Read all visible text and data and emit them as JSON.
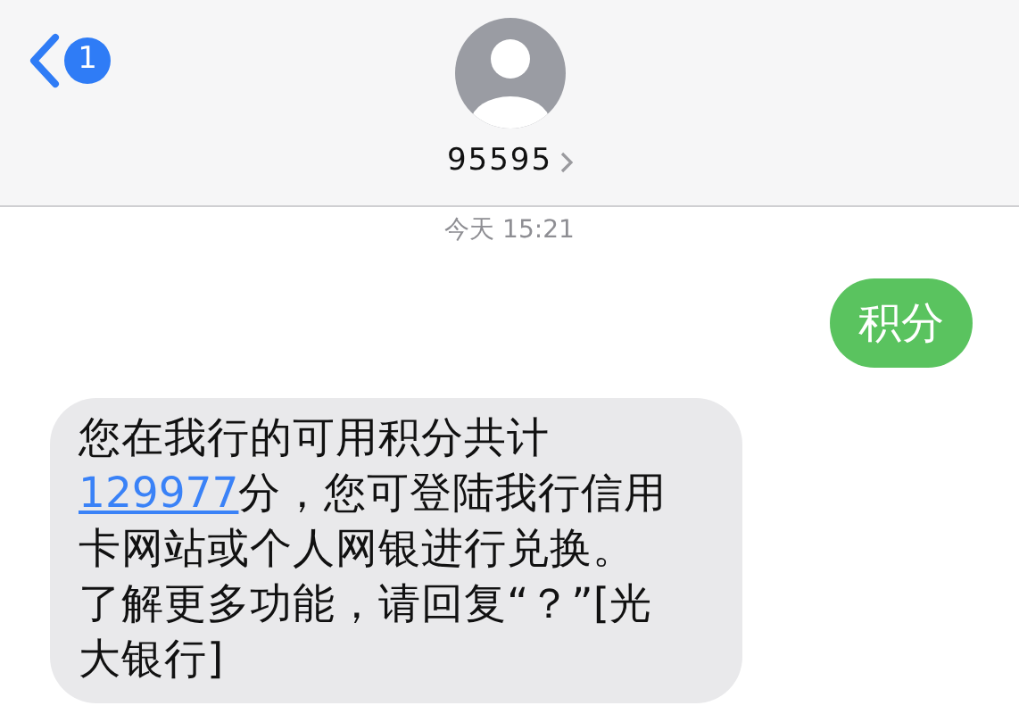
{
  "header": {
    "unread_count": "1",
    "contact_name": "95595"
  },
  "timestamp": "今天 15:21",
  "messages": [
    {
      "kind": "sent",
      "lines": [
        [
          {
            "kind": "text",
            "text": "积分"
          }
        ]
      ]
    },
    {
      "kind": "received",
      "lines": [
        [
          {
            "kind": "text",
            "text": "您在我行的可用积分共计"
          }
        ],
        [
          {
            "kind": "link",
            "text": "129977"
          },
          {
            "kind": "text",
            "text": "分，您可登陆我行信用"
          }
        ],
        [
          {
            "kind": "text",
            "text": "卡网站或个人网银进行兑换。"
          }
        ],
        [
          {
            "kind": "text",
            "text": "了解更多功能，请回复“？”[光"
          }
        ],
        [
          {
            "kind": "text",
            "text": "大银行]"
          }
        ]
      ]
    }
  ]
}
